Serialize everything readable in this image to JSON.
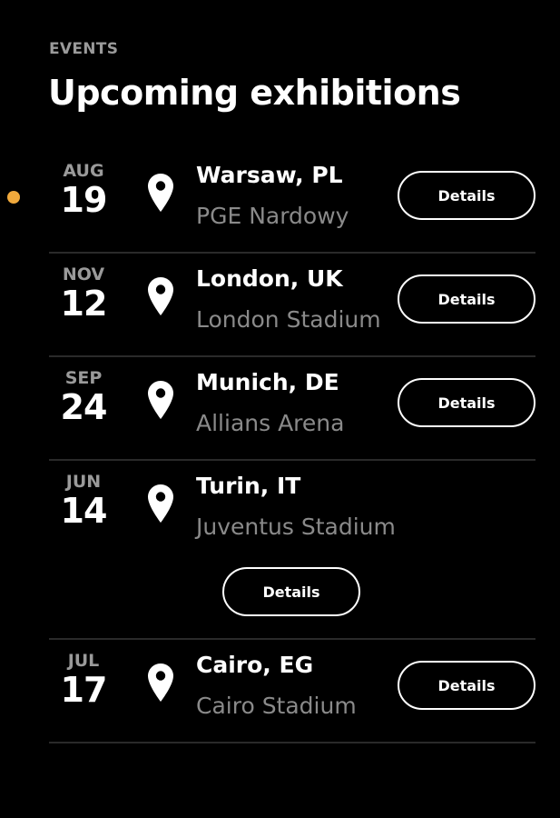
{
  "header": {
    "eyebrow": "EVENTS",
    "title": "Upcoming exhibitions"
  },
  "colors": {
    "background": "#000000",
    "accent_dot": "#f0a93c",
    "muted_text": "#8a8a8a",
    "divider": "#2a2a2a"
  },
  "events": [
    {
      "month": "AUG",
      "day": "19",
      "city": "Warsaw, PL",
      "venue": "PGE Nardowy",
      "button": "Details",
      "icon": "location-pin-icon"
    },
    {
      "month": "NOV",
      "day": "12",
      "city": "London, UK",
      "venue": "London Stadium",
      "button": "Details",
      "icon": "location-pin-icon"
    },
    {
      "month": "SEP",
      "day": "24",
      "city": "Munich, DE",
      "venue": "Allians Arena",
      "button": "Details",
      "icon": "location-pin-icon"
    },
    {
      "month": "JUN",
      "day": "14",
      "city": "Turin, IT",
      "venue": "Juventus Stadium",
      "button": "Details",
      "icon": "location-pin-icon"
    },
    {
      "month": "JUL",
      "day": "17",
      "city": "Cairo, EG",
      "venue": "Cairo Stadium",
      "button": "Details",
      "icon": "location-pin-icon"
    }
  ]
}
